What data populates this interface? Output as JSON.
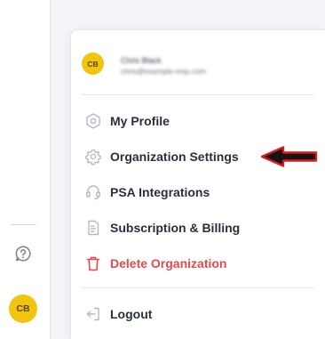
{
  "user": {
    "initials": "CB",
    "name": "Chris Black",
    "email": "chris@example-msp.com",
    "avatar_color": "#f2c40f"
  },
  "menu": {
    "items": [
      {
        "label": "My Profile",
        "icon": "profile-icon"
      },
      {
        "label": "Organization Settings",
        "icon": "gear-icon"
      },
      {
        "label": "PSA Integrations",
        "icon": "headset-icon"
      },
      {
        "label": "Subscription & Billing",
        "icon": "receipt-icon"
      },
      {
        "label": "Delete Organization",
        "icon": "trash-icon",
        "color": "#e5484d"
      }
    ],
    "logout": {
      "label": "Logout",
      "icon": "logout-icon"
    }
  },
  "rail": {
    "help_icon": "help-icon",
    "avatar_initials": "CB"
  },
  "annotation": {
    "arrow_color": "#e0191f",
    "icon": "annotation-arrow-icon"
  },
  "colors": {
    "text": "#2a2f3d",
    "icon_gray": "#b3b8c4",
    "danger": "#e5484d",
    "avatar": "#f2c40f"
  }
}
